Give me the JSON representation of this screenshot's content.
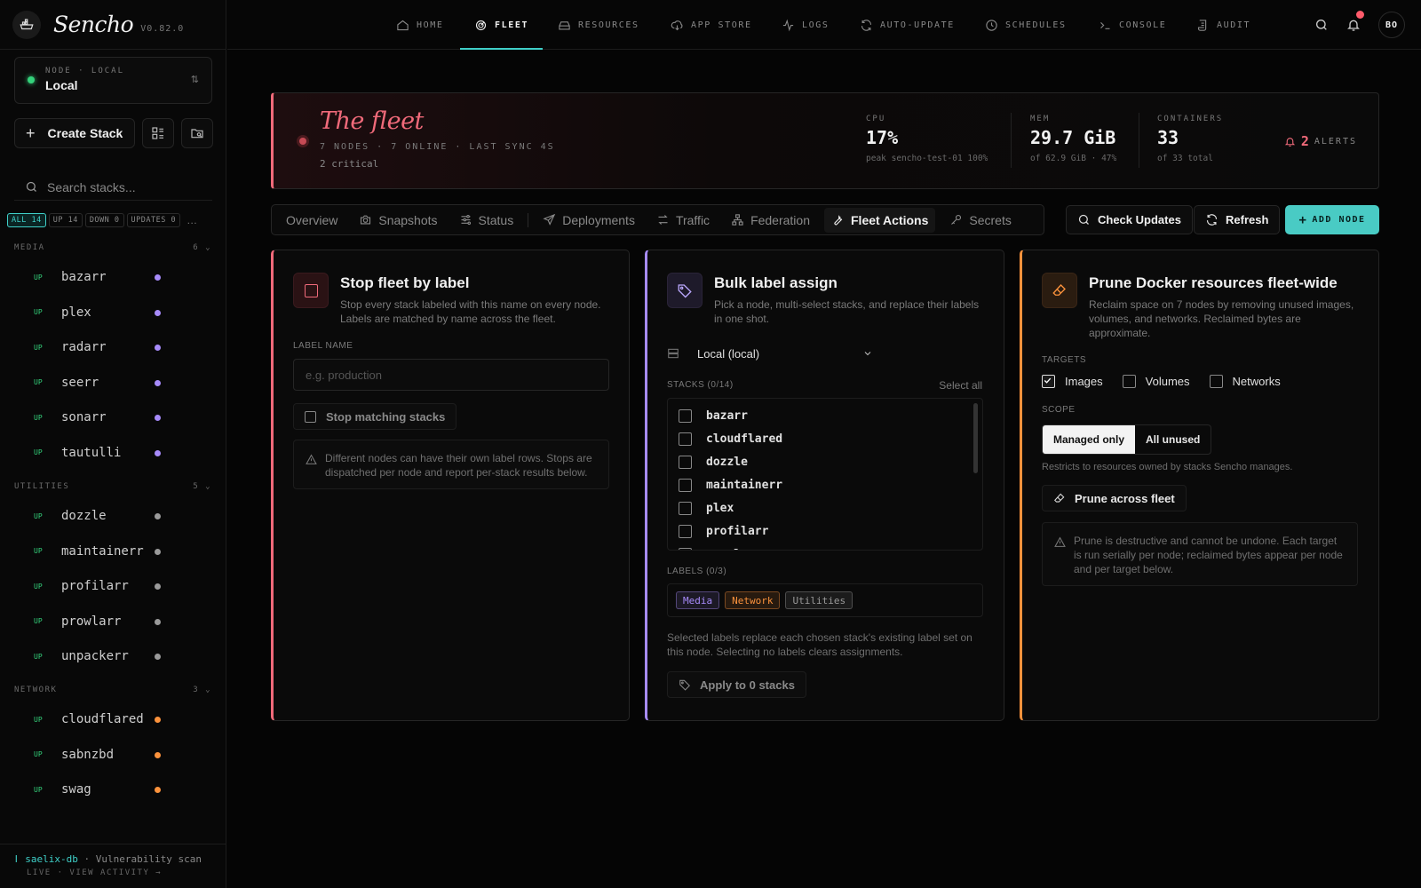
{
  "app": {
    "name": "Sencho",
    "version": "V0.82.0"
  },
  "node_selector": {
    "label": "NODE · LOCAL",
    "value": "Local"
  },
  "sidebar": {
    "create_label": "Create Stack",
    "search_placeholder": "Search stacks...",
    "filters": [
      "ALL 14",
      "UP 14",
      "DOWN 0",
      "UPDATES 0"
    ],
    "more": "…",
    "groups": [
      {
        "name": "MEDIA",
        "count": "6",
        "color": "#a78bfa",
        "items": [
          "bazarr",
          "plex",
          "radarr",
          "seerr",
          "sonarr",
          "tautulli"
        ]
      },
      {
        "name": "UTILITIES",
        "count": "5",
        "color": "#9a9a9a",
        "items": [
          "dozzle",
          "maintainerr",
          "profilarr",
          "prowlarr",
          "unpackerr"
        ]
      },
      {
        "name": "NETWORK",
        "count": "3",
        "color": "#fb923c",
        "items": [
          "cloudflared",
          "sabnzbd",
          "swag"
        ]
      }
    ],
    "status_label": "UP",
    "activity": {
      "name": "saelix-db",
      "text": "· Vulnerability scan",
      "live": "LIVE · VIEW ACTIVITY →"
    }
  },
  "nav": {
    "items": [
      "HOME",
      "FLEET",
      "RESOURCES",
      "APP STORE",
      "LOGS",
      "AUTO-UPDATE",
      "SCHEDULES",
      "CONSOLE",
      "AUDIT"
    ],
    "active": "FLEET",
    "avatar": "BO"
  },
  "hero": {
    "title": "The fleet",
    "subtitle": "7 NODES · 7 ONLINE · LAST SYNC 4S",
    "critical": "2 critical",
    "cpu": {
      "label": "CPU",
      "value": "17%",
      "sub": "peak sencho-test-01 100%"
    },
    "mem": {
      "label": "MEM",
      "value": "29.7 GiB",
      "sub": "of 62.9 GiB · 47%"
    },
    "containers": {
      "label": "CONTAINERS",
      "value": "33",
      "sub": "of 33 total"
    },
    "alerts": {
      "count": "2",
      "label": "ALERTS"
    }
  },
  "tabs": [
    "Overview",
    "Snapshots",
    "Status",
    "Deployments",
    "Traffic",
    "Federation",
    "Fleet Actions",
    "Secrets"
  ],
  "active_tab": "Fleet Actions",
  "actions": {
    "check": "Check Updates",
    "refresh": "Refresh",
    "add": "ADD NODE"
  },
  "card_stop": {
    "title": "Stop fleet by label",
    "desc": "Stop every stack labeled with this name on every node. Labels are matched by name across the fleet.",
    "field_label": "LABEL NAME",
    "placeholder": "e.g. production",
    "button": "Stop matching stacks",
    "note": "Different nodes can have their own label rows. Stops are dispatched per node and report per-stack results below."
  },
  "card_label": {
    "title": "Bulk label assign",
    "desc": "Pick a node, multi-select stacks, and replace their labels in one shot.",
    "node": "Local (local)",
    "stacks_label": "STACKS (0/14)",
    "select_all": "Select all",
    "stacks": [
      "bazarr",
      "cloudflared",
      "dozzle",
      "maintainerr",
      "plex",
      "profilarr",
      "prowlarr"
    ],
    "labels_label": "LABELS (0/3)",
    "labels": [
      {
        "name": "Media",
        "color": "#a78bfa"
      },
      {
        "name": "Network",
        "color": "#fb923c"
      },
      {
        "name": "Utilities",
        "color": "#9a9a9a"
      }
    ],
    "hint": "Selected labels replace each chosen stack's existing label set on this node. Selecting no labels clears assignments.",
    "button": "Apply to 0 stacks"
  },
  "card_prune": {
    "title": "Prune Docker resources fleet-wide",
    "desc": "Reclaim space on 7 nodes by removing unused images, volumes, and networks. Reclaimed bytes are approximate.",
    "targets_label": "TARGETS",
    "targets": [
      {
        "name": "Images",
        "checked": true
      },
      {
        "name": "Volumes",
        "checked": false
      },
      {
        "name": "Networks",
        "checked": false
      }
    ],
    "scope_label": "SCOPE",
    "scope": [
      "Managed only",
      "All unused"
    ],
    "scope_hint": "Restricts to resources owned by stacks Sencho manages.",
    "button": "Prune across fleet",
    "note": "Prune is destructive and cannot be undone. Each target is run serially per node; reclaimed bytes appear per node and per target below."
  }
}
